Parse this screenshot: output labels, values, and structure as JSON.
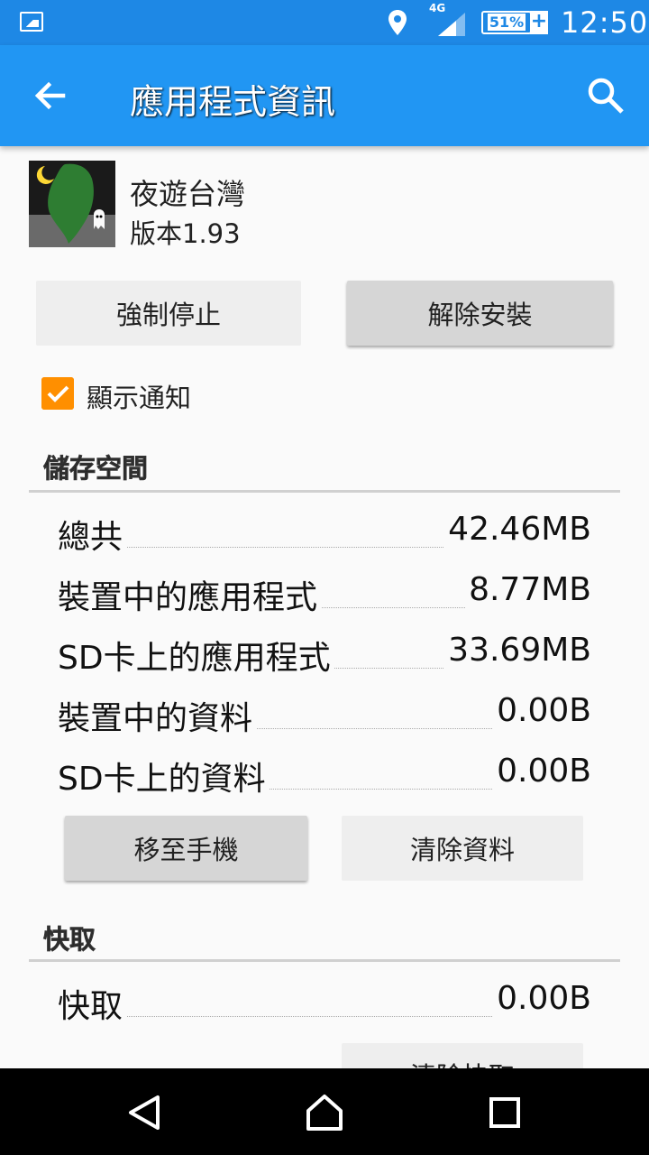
{
  "status_bar": {
    "network": "4G",
    "battery": "51%",
    "time": "12:50",
    "icons": [
      "gallery-notification-icon",
      "location-icon",
      "signal-icon",
      "battery-icon",
      "charging-icon"
    ]
  },
  "app_bar": {
    "title": "應用程式資訊",
    "back_icon": "arrow-back-icon",
    "search_icon": "search-icon"
  },
  "app": {
    "name": "夜遊台灣",
    "version": "版本1.93"
  },
  "actions": {
    "force_stop": "強制停止",
    "uninstall": "解除安裝"
  },
  "notifications": {
    "label": "顯示通知",
    "checked": true
  },
  "storage": {
    "title": "儲存空間",
    "rows": [
      {
        "label": "總共",
        "value": "42.46MB"
      },
      {
        "label": "裝置中的應用程式",
        "value": "8.77MB"
      },
      {
        "label": "SD卡上的應用程式",
        "value": "33.69MB"
      },
      {
        "label": "裝置中的資料",
        "value": "0.00B"
      },
      {
        "label": "SD卡上的資料",
        "value": "0.00B"
      }
    ],
    "move_button": "移至手機",
    "clear_data_button": "清除資料"
  },
  "cache": {
    "title": "快取",
    "rows": [
      {
        "label": "快取",
        "value": "0.00B"
      }
    ],
    "clear_cache_button": "清除快取"
  },
  "nav_bar": {
    "back": "nav-back-icon",
    "home": "nav-home-icon",
    "recents": "nav-recents-icon"
  },
  "colors": {
    "status_bar": "#1e88e5",
    "app_bar": "#2196f3",
    "checkbox": "#ff8f00",
    "background": "#fafafa"
  }
}
